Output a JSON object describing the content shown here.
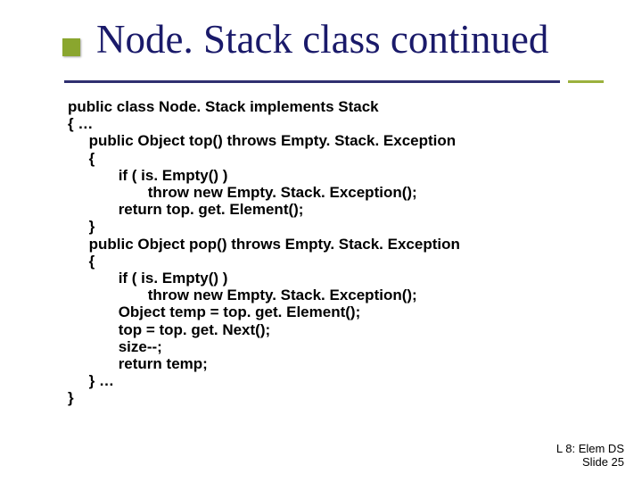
{
  "title": "Node. Stack class continued",
  "code": {
    "l1": "public class Node. Stack implements Stack",
    "l2": "{ …",
    "l3": "public Object top() throws Empty. Stack. Exception",
    "l4": "{",
    "l5": "if ( is. Empty() )",
    "l6": "throw new Empty. Stack. Exception();",
    "l7": "return top. get. Element();",
    "l8": "}",
    "l9": "public Object pop() throws Empty. Stack. Exception",
    "l10": "{",
    "l11": "if ( is. Empty() )",
    "l12": "throw new Empty. Stack. Exception();",
    "l13": "Object temp = top. get. Element();",
    "l14": "top = top. get. Next();",
    "l15": "size--;",
    "l16": "return temp;",
    "l17": "} …",
    "l18": "}"
  },
  "footer": {
    "line1": "L 8: Elem DS",
    "line2": "Slide 25"
  }
}
